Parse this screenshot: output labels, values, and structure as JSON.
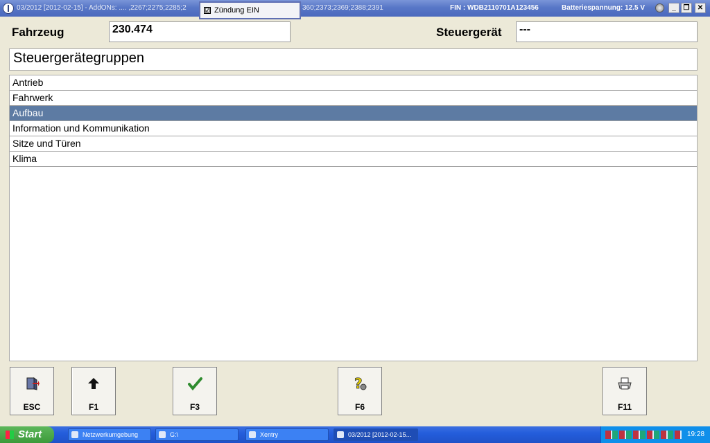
{
  "titlebar": {
    "title_left": "03/2012 [2012-02-15] - AddONs: .... ,2267;2275;2285;2",
    "title_right": "360;2373;2369;2388;2391",
    "fin": "FIN : WDB2110701A123456",
    "battery": "Batteriespannung: 12.5 V",
    "minimize": "_",
    "restore": "❐",
    "close": "✕"
  },
  "ignition": {
    "checked": "☑",
    "label": "Zündung EIN"
  },
  "header": {
    "vehicle_label": "Fahrzeug",
    "vehicle_value": "230.474",
    "ecu_label": "Steuergerät",
    "ecu_value": "---"
  },
  "group_title": "Steuergerätegruppen",
  "groups": [
    {
      "label": "Antrieb",
      "selected": false
    },
    {
      "label": "Fahrwerk",
      "selected": false
    },
    {
      "label": "Aufbau",
      "selected": true
    },
    {
      "label": "Information und Kommunikation",
      "selected": false
    },
    {
      "label": "Sitze und Türen",
      "selected": false
    },
    {
      "label": "Klima",
      "selected": false
    }
  ],
  "fkeys": [
    {
      "key": "ESC",
      "icon": "exit-door-icon"
    },
    {
      "key": "F1",
      "icon": "arrow-up-icon"
    },
    {
      "key": "F3",
      "icon": "checkmark-icon"
    },
    {
      "key": "F6",
      "icon": "help-icon"
    },
    {
      "key": "F11",
      "icon": "printer-icon"
    }
  ],
  "taskbar": {
    "start": "Start",
    "tasks": [
      "Netzwerkumgebung",
      "G:\\",
      "Xentry",
      "03/2012 [2012-02-15..."
    ],
    "clock": "19:28"
  },
  "colors": {
    "selection": "#5D7BA3",
    "titlebar": "#5877C7",
    "taskbar": "#245EDC",
    "window_bg": "#ECE9D8"
  }
}
